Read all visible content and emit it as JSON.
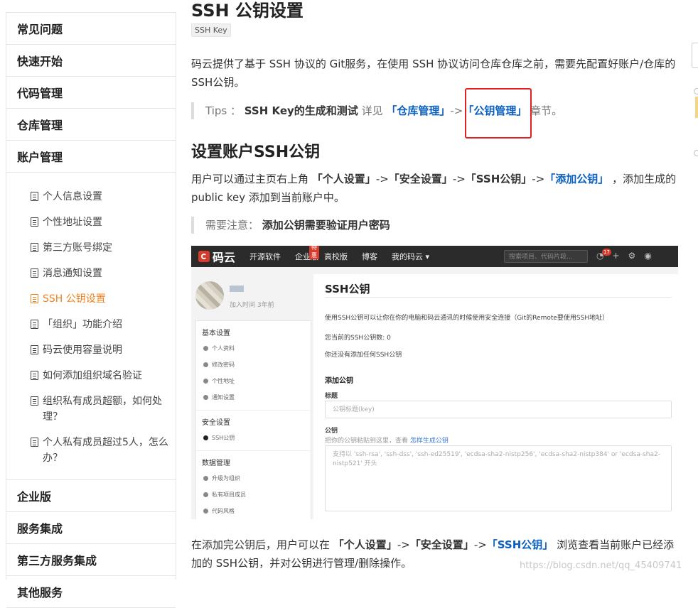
{
  "sidebar": {
    "sections_top": [
      "常见问题",
      "快速开始",
      "代码管理",
      "仓库管理",
      "账户管理"
    ],
    "items": [
      {
        "label": "个人信息设置"
      },
      {
        "label": "个性地址设置"
      },
      {
        "label": "第三方账号绑定"
      },
      {
        "label": "消息通知设置"
      },
      {
        "label": "SSH 公钥设置"
      },
      {
        "label": "「组织」功能介绍"
      },
      {
        "label": "码云使用容量说明"
      },
      {
        "label": "如何添加组织域名验证"
      },
      {
        "label": "组织私有成员超额，如何处理？"
      },
      {
        "label": "个人私有成员超过5人，怎么办？"
      }
    ],
    "active_index": 4,
    "sections_bottom": [
      "企业版",
      "服务集成",
      "第三方服务集成",
      "其他服务"
    ]
  },
  "article": {
    "title": "SSH 公钥设置",
    "tag": "SSH Key",
    "intro": "码云提供了基于 SSH 协议的 Git服务，在使用 SSH 协议访问仓库仓库之前，需要先配置好账户/仓库的SSH公钥。",
    "tips": {
      "prefix": "Tips ：",
      "bold": "SSH Key的生成和测试",
      "mid": "详见",
      "link1": "「仓库管理」",
      "arrow": "->",
      "link2": "「公钥管理」",
      "suffix": "章节。"
    },
    "h2": "设置账户SSH公钥",
    "steps": {
      "prefix": "用户可以通过主页右上角",
      "s1": "「个人设置」",
      "s2": "「安全设置」",
      "s3": "「SSH公钥」",
      "s4": "「添加公钥」",
      "arrow": "->",
      "suffix": "，添加生成的 public key 添加到当前账户中。"
    },
    "note": {
      "prefix": "需要注意：",
      "bold": "添加公钥需要验证用户密码"
    },
    "after": {
      "prefix": "在添加完公钥后，用户可以在",
      "s1": "「个人设置」",
      "s2": "「安全设置」",
      "s3": "「SSH公钥」",
      "arrow": "->",
      "suffix": "浏览查看当前账户已经添加的 SSH公钥，并对公钥进行管理/删除操作。"
    }
  },
  "screenshot": {
    "logo": "码云",
    "nav": [
      "开源软件",
      "企业版",
      "高校版",
      "博客",
      "我的码云 ▾"
    ],
    "hot": "特惠",
    "search_placeholder": "搜索项目、代码片段...",
    "badge": "17",
    "joined": "加入时间 3年前",
    "left_menu": {
      "g1": "基本设置",
      "g1_items": [
        "个人资料",
        "修改密码",
        "个性地址",
        "通知设置"
      ],
      "g2": "安全设置",
      "g2_items": [
        "SSH公钥"
      ],
      "g3": "数据管理",
      "g3_items": [
        "升级为组织",
        "私有项目成员",
        "代码风格"
      ]
    },
    "panel": {
      "title": "SSH公钥",
      "desc": "使用SSH公钥可以让你在你的电脑和码云通讯的时候使用安全连接（Git的Remote要使用SSH地址）",
      "count": "您当前的SSH公钥数: 0",
      "none": "你还没有添加任何SSH公钥",
      "add_title": "添加公钥",
      "label_title": "标题",
      "title_placeholder": "公钥标题(key)",
      "label_key": "公钥",
      "key_hint": "把你的公钥粘贴到这里，查看",
      "key_hint_link": "怎样生成公钥",
      "key_placeholder": "支持以 'ssh-rsa', 'ssh-dss', 'ssh-ed25519', 'ecdsa-sha2-nistp256', 'ecdsa-sha2-nistp384' or 'ecdsa-sha2-nistp521' 开头"
    }
  },
  "watermark": "https://blog.csdn.net/qq_45409741"
}
